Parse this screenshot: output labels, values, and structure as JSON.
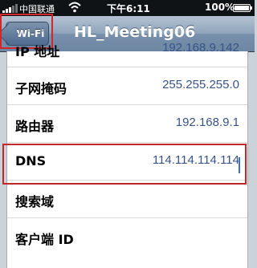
{
  "status_bar": {
    "carrier": "中国联通",
    "time": "下午6:11",
    "battery": "100%"
  },
  "nav": {
    "back_label": "Wi-Fi",
    "title": "HL_Meeting06"
  },
  "rows": [
    {
      "label": "IP 地址",
      "value": "192.168.9.142"
    },
    {
      "label": "子网掩码",
      "value": "255.255.255.0"
    },
    {
      "label": "路由器",
      "value": "192.168.9.1"
    },
    {
      "label": "DNS",
      "value": "114.114.114.114"
    },
    {
      "label": "搜索域",
      "value": ""
    },
    {
      "label": "客户端 ID",
      "value": ""
    }
  ],
  "colors": {
    "highlight": "#c2272c",
    "value_text": "#385487",
    "nav_bar": "#7890ab"
  }
}
